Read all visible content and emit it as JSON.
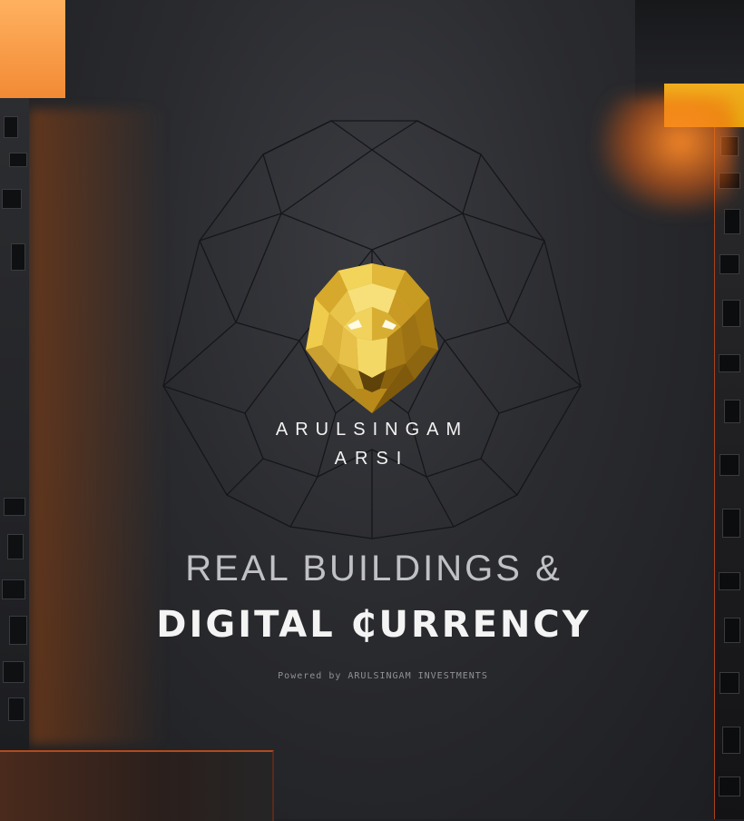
{
  "brand": {
    "name": "ARULSINGAM",
    "short": "ARSI"
  },
  "headline": {
    "line1": "REAL BUILDINGS &",
    "line2": "DIGITAL ₵URRENCY"
  },
  "footer": {
    "powered_by": "Powered by ARULSINGAM INVESTMENTS"
  },
  "colors": {
    "background": "#2a2b2f",
    "accent_orange": "#f28a35",
    "accent_yellow": "#f2b01e",
    "lion_gold": "#d9b23a"
  },
  "icons": {
    "logo": "lion-head-icon",
    "background_pattern": "lion-wireframe-icon"
  }
}
